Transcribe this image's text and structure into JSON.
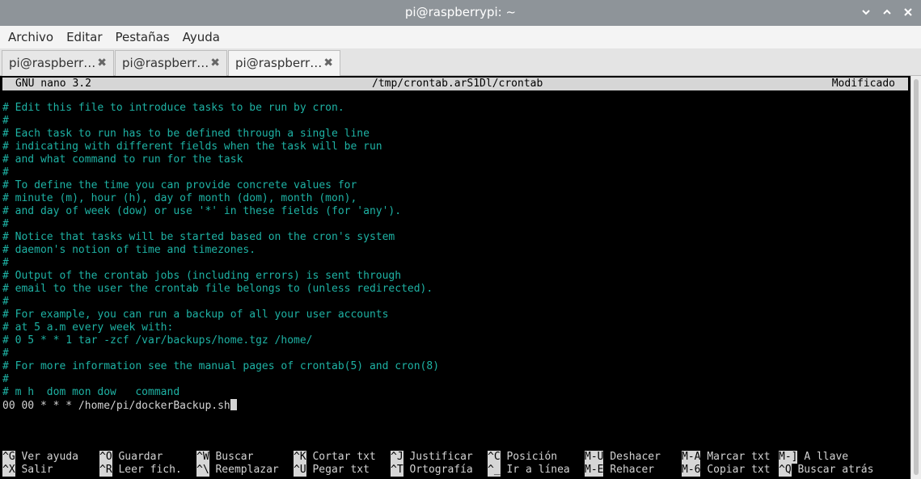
{
  "window": {
    "title": "pi@raspberrypi: ~",
    "buttons": [
      "minimize-icon",
      "maximize-icon",
      "close-icon"
    ]
  },
  "menu": [
    "Archivo",
    "Editar",
    "Pestañas",
    "Ayuda"
  ],
  "tabs": [
    {
      "label": "pi@raspberr…",
      "active": false
    },
    {
      "label": "pi@raspberr…",
      "active": false
    },
    {
      "label": "pi@raspberr…",
      "active": true
    }
  ],
  "nano": {
    "version": "GNU nano 3.2",
    "file": "/tmp/crontab.arS1Dl/crontab",
    "status": "Modificado"
  },
  "lines": [
    "# Edit this file to introduce tasks to be run by cron.",
    "#",
    "# Each task to run has to be defined through a single line",
    "# indicating with different fields when the task will be run",
    "# and what command to run for the task",
    "#",
    "# To define the time you can provide concrete values for",
    "# minute (m), hour (h), day of month (dom), month (mon),",
    "# and day of week (dow) or use '*' in these fields (for 'any').",
    "#",
    "# Notice that tasks will be started based on the cron's system",
    "# daemon's notion of time and timezones.",
    "#",
    "# Output of the crontab jobs (including errors) is sent through",
    "# email to the user the crontab file belongs to (unless redirected).",
    "#",
    "# For example, you can run a backup of all your user accounts",
    "# at 5 a.m every week with:",
    "# 0 5 * * 1 tar -zcf /var/backups/home.tgz /home/",
    "#",
    "# For more information see the manual pages of crontab(5) and cron(8)",
    "#",
    "# m h  dom mon dow   command"
  ],
  "command_line": "00 00 * * * /home/pi/dockerBackup.sh",
  "shortcuts": [
    [
      {
        "key": "^G",
        "label": "Ver ayuda"
      },
      {
        "key": "^O",
        "label": "Guardar"
      },
      {
        "key": "^W",
        "label": "Buscar"
      },
      {
        "key": "^K",
        "label": "Cortar txt"
      },
      {
        "key": "^J",
        "label": "Justificar"
      },
      {
        "key": "^C",
        "label": "Posición"
      },
      {
        "key": "M-U",
        "label": "Deshacer"
      },
      {
        "key": "M-A",
        "label": "Marcar txt"
      },
      {
        "key": "M-]",
        "label": "A llave"
      }
    ],
    [
      {
        "key": "^X",
        "label": "Salir"
      },
      {
        "key": "^R",
        "label": "Leer fich."
      },
      {
        "key": "^\\",
        "label": "Reemplazar"
      },
      {
        "key": "^U",
        "label": "Pegar txt"
      },
      {
        "key": "^T",
        "label": "Ortografía"
      },
      {
        "key": "^_",
        "label": "Ir a línea"
      },
      {
        "key": "M-E",
        "label": "Rehacer"
      },
      {
        "key": "M-6",
        "label": "Copiar txt"
      },
      {
        "key": "^Q",
        "label": "Buscar atrás"
      }
    ]
  ],
  "colors": {
    "comment": "#1eb2a4",
    "text": "#d3d3d3",
    "terminal_bg": "#000000",
    "bar_bg": "#d6d6d6"
  }
}
